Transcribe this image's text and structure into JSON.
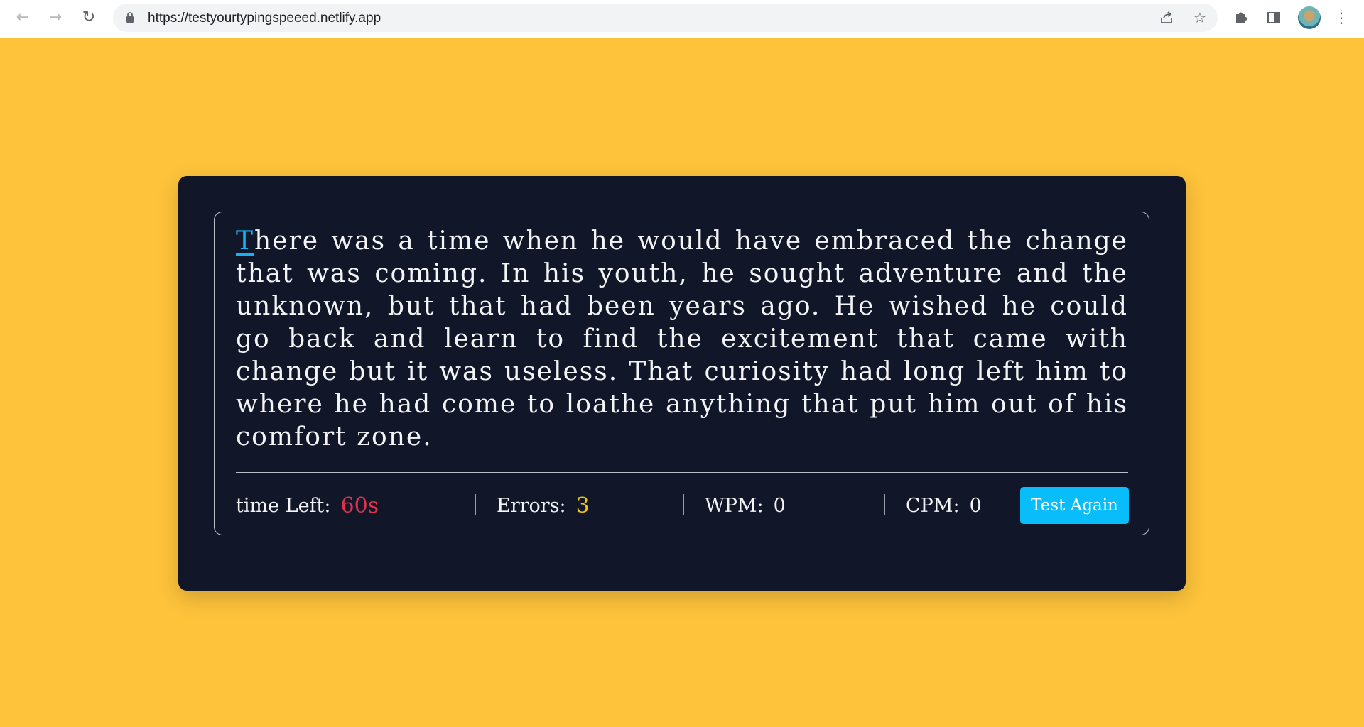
{
  "browser": {
    "url": "https://testyourtypingspeeed.netlify.app",
    "icons": {
      "back": "arrow-left-icon",
      "forward": "arrow-right-icon",
      "reload": "reload-icon",
      "lock": "lock-icon",
      "share": "share-icon",
      "bookmark": "star-icon",
      "extensions": "puzzle-icon",
      "side_panel": "side-panel-icon",
      "profile": "avatar",
      "menu": "kebab-menu-icon"
    }
  },
  "typing": {
    "active_char": "T",
    "rest_text": "here was a time when he would have embraced the change that was coming. In his youth, he sought adventure and the unknown, but that had been years ago. He wished he could go back and learn to find the excitement that came with change but it was useless. That curiosity had long left him to where he had come to loathe anything that put him out of his comfort zone."
  },
  "stats": {
    "time_label": "time Left:",
    "time_value": "60s",
    "errors_label": "Errors:",
    "errors_value": "3",
    "wpm_label": "WPM:",
    "wpm_value": "0",
    "cpm_label": "CPM:",
    "cpm_value": "0",
    "button_label": "Test Again"
  },
  "colors": {
    "page_background": "#fec33b",
    "card_background": "#111729",
    "active_char": "#17b2f3",
    "time_value": "#e0334a",
    "errors_value": "#f2c21b",
    "button": "#08bdf9"
  }
}
